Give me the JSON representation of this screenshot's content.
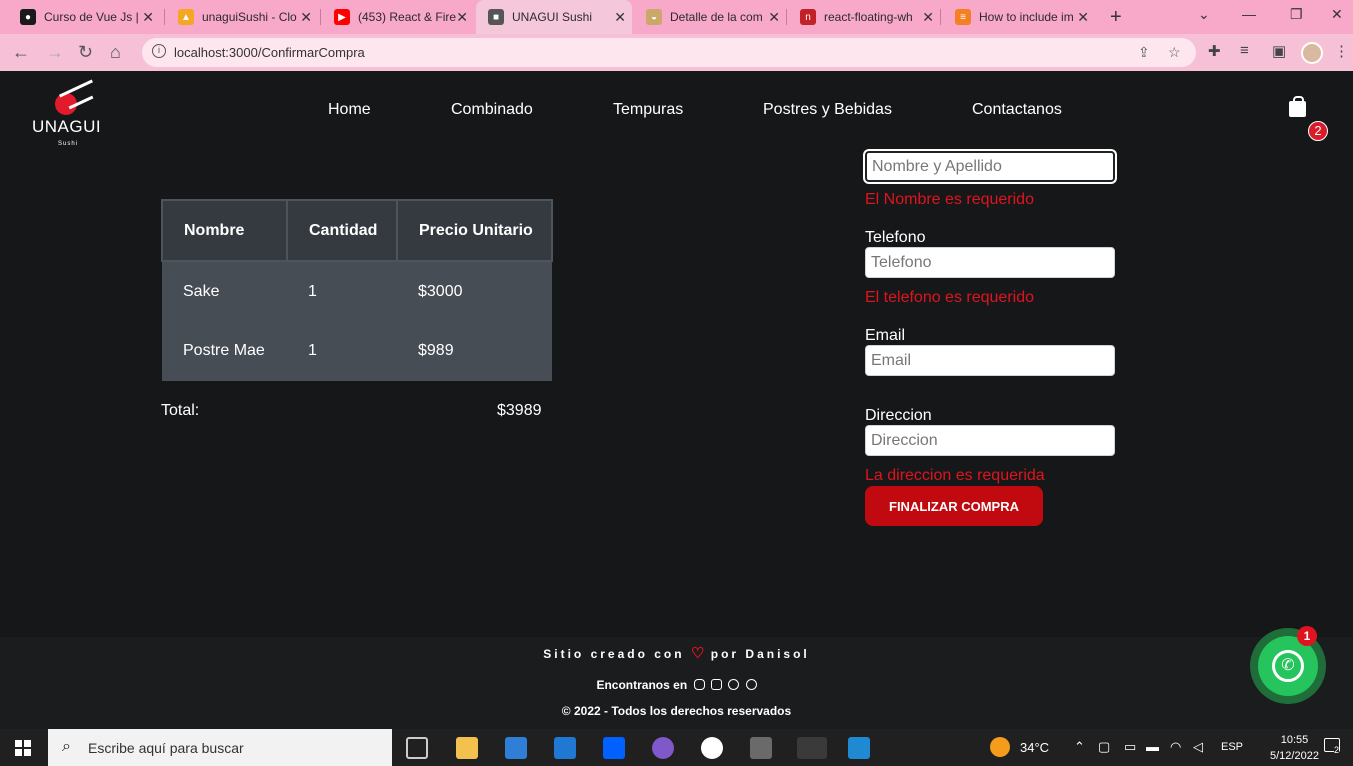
{
  "browser": {
    "tabs": [
      {
        "label": "Curso de Vue Js |",
        "icon": "generic-site-icon",
        "color": "#1a1a1a"
      },
      {
        "label": "unaguiSushi - Clo",
        "icon": "firebase-icon",
        "color": "#f5a623"
      },
      {
        "label": "(453) React & Fire",
        "icon": "youtube-icon",
        "color": "#ff0000"
      },
      {
        "label": "UNAGUI Sushi",
        "icon": "site-favicon",
        "color": "#555"
      },
      {
        "label": "Detalle de la com",
        "icon": "food-icon",
        "color": "#c9a86a"
      },
      {
        "label": "react-floating-wh",
        "icon": "npm-icon",
        "color": "#c12127"
      },
      {
        "label": "How to include im",
        "icon": "stackoverflow-icon",
        "color": "#f48024"
      }
    ],
    "active_tab": 3,
    "url": "localhost:3000/ConfirmarCompra"
  },
  "site": {
    "logo_word": "UNAGUI",
    "logo_sub": "Sushi",
    "nav": [
      "Home",
      "Combinado",
      "Tempuras",
      "Postres y Bebidas",
      "Contactanos"
    ],
    "cart_count": "2"
  },
  "order": {
    "headers": [
      "Nombre",
      "Cantidad",
      "Precio Unitario"
    ],
    "rows": [
      [
        "Sake",
        "1",
        "$3000"
      ],
      [
        "Postre Mae",
        "1",
        "$989"
      ]
    ],
    "total_label": "Total:",
    "total_value": "$3989"
  },
  "form": {
    "name_placeholder": "Nombre y Apellido",
    "name_error": "El Nombre es requerido",
    "phone_label": "Telefono",
    "phone_placeholder": "Telefono",
    "phone_error": "El telefono es requerido",
    "email_label": "Email",
    "email_placeholder": "Email",
    "address_label": "Direccion",
    "address_placeholder": "Direccion",
    "address_error": "La direccion es requerida",
    "submit": "FINALIZAR COMPRA"
  },
  "footer": {
    "credit_pre": "Sitio creado con",
    "credit_post": "por Danisol",
    "social": "Encontranos en",
    "copyright": "© 2022 - Todos los derechos reservados"
  },
  "whatsapp": {
    "badge": "1"
  },
  "taskbar": {
    "search_placeholder": "Escribe aquí para buscar",
    "temperature": "34°C",
    "language": "ESP",
    "time": "10:55",
    "date": "5/12/2022",
    "notifications": "2"
  },
  "colors": {
    "accent_red": "#c00a10",
    "error_red": "#e0141e",
    "browser_pink": "#f8a8c8",
    "page_bg": "#161719"
  }
}
